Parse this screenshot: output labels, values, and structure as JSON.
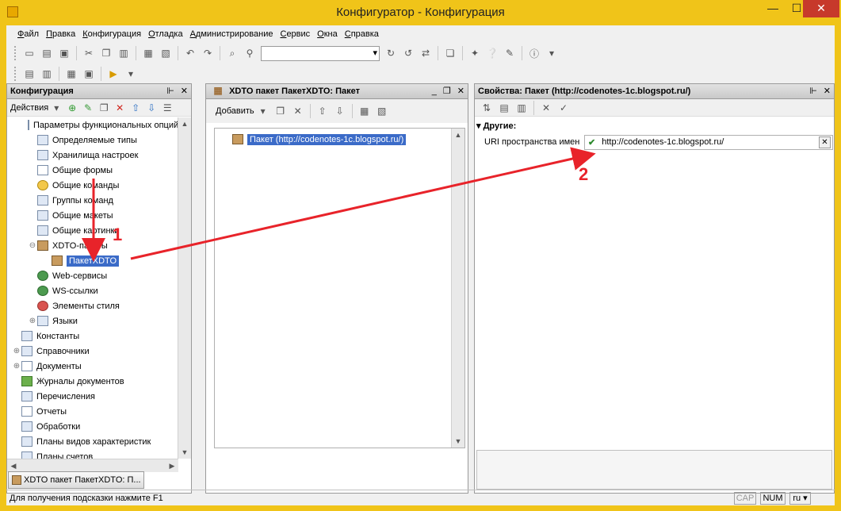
{
  "window": {
    "title": "Конфигуратор - Конфигурация",
    "minimize": "—",
    "maximize": "☐",
    "close": "✕"
  },
  "menu": [
    "Файл",
    "Правка",
    "Конфигурация",
    "Отладка",
    "Администрирование",
    "Сервис",
    "Окна",
    "Справка"
  ],
  "tree_panel": {
    "title": "Конфигурация",
    "actions_label": "Действия",
    "items": [
      {
        "label": "Параметры функциональных опций",
        "level": 2,
        "icon": "params-icon",
        "toggle": ""
      },
      {
        "label": "Определяемые типы",
        "level": 2,
        "icon": "types-icon",
        "toggle": ""
      },
      {
        "label": "Хранилища настроек",
        "level": 2,
        "icon": "storage-icon",
        "toggle": ""
      },
      {
        "label": "Общие формы",
        "level": 2,
        "icon": "form-icon",
        "toggle": ""
      },
      {
        "label": "Общие команды",
        "level": 2,
        "icon": "command-icon",
        "toggle": ""
      },
      {
        "label": "Группы команд",
        "level": 2,
        "icon": "group-icon",
        "toggle": ""
      },
      {
        "label": "Общие макеты",
        "level": 2,
        "icon": "layout-icon",
        "toggle": ""
      },
      {
        "label": "Общие картинки",
        "level": 2,
        "icon": "picture-icon",
        "toggle": ""
      },
      {
        "label": "XDTO-пакеты",
        "level": 2,
        "icon": "package-icon",
        "toggle": "⊖"
      },
      {
        "label": "ПакетXDTO",
        "level": 3,
        "icon": "package-icon",
        "toggle": "",
        "selected": true
      },
      {
        "label": "Web-сервисы",
        "level": 2,
        "icon": "web-service-icon",
        "toggle": ""
      },
      {
        "label": "WS-ссылки",
        "level": 2,
        "icon": "ws-link-icon",
        "toggle": ""
      },
      {
        "label": "Элементы стиля",
        "level": 2,
        "icon": "style-icon",
        "toggle": ""
      },
      {
        "label": "Языки",
        "level": 2,
        "icon": "language-icon",
        "toggle": "⊕"
      },
      {
        "label": "Константы",
        "level": 1,
        "icon": "constants-icon",
        "toggle": ""
      },
      {
        "label": "Справочники",
        "level": 1,
        "icon": "catalogs-icon",
        "toggle": "⊕"
      },
      {
        "label": "Документы",
        "level": 1,
        "icon": "documents-icon",
        "toggle": "⊕"
      },
      {
        "label": "Журналы документов",
        "level": 1,
        "icon": "journal-icon",
        "toggle": ""
      },
      {
        "label": "Перечисления",
        "level": 1,
        "icon": "enum-icon",
        "toggle": ""
      },
      {
        "label": "Отчеты",
        "level": 1,
        "icon": "report-icon",
        "toggle": ""
      },
      {
        "label": "Обработки",
        "level": 1,
        "icon": "processing-icon",
        "toggle": ""
      },
      {
        "label": "Планы видов характеристик",
        "level": 1,
        "icon": "chart-types-icon",
        "toggle": ""
      },
      {
        "label": "Планы счетов",
        "level": 1,
        "icon": "accounts-icon",
        "toggle": ""
      }
    ]
  },
  "xdto_panel": {
    "title": "XDTO пакет ПакетXDTO: Пакет",
    "add_label": "Добавить",
    "package_item": "Пакет (http://codenotes-1c.blogspot.ru/)"
  },
  "props_panel": {
    "title": "Свойства: Пакет (http://codenotes-1c.blogspot.ru/)",
    "group": "Другие:",
    "property_label": "URI пространства имен",
    "property_value": "http://codenotes-1c.blogspot.ru/"
  },
  "window_tab": "XDTO пакет ПакетXDTO: П...",
  "status": {
    "hint": "Для получения подсказки нажмите F1",
    "cap": "CAP",
    "num": "NUM",
    "lang": "ru"
  },
  "annotations": {
    "num1": "1",
    "num2": "2",
    "color": "#e8232a"
  }
}
